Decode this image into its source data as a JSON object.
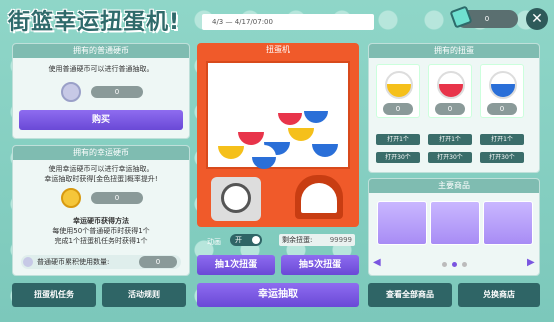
{
  "title": "街篮幸运扭蛋机!",
  "date_range": "4/3 — 4/17/07:00",
  "currency": {
    "value": "0"
  },
  "normal_coin": {
    "header": "拥有的普通硬币",
    "desc": "使用普通硬币可以进行普通抽取。",
    "count": "0",
    "buy_label": "购买"
  },
  "lucky_coin": {
    "header": "拥有的幸运硬币",
    "desc": [
      "使用幸运硬币可以进行幸运抽取。",
      "幸运抽取时获得[金色扭蛋]概率提升!"
    ],
    "count": "0",
    "method_title": "幸运硬币获得方法",
    "method_lines": [
      "每使用50个普通硬币时获得1个",
      "完成1个扭蛋机任务时获得1个"
    ],
    "accum_label": "普通硬币累积使用数量:",
    "accum_value": "0"
  },
  "machine": {
    "header": "扭蛋机",
    "anim_label": "动画",
    "toggle_label": "开",
    "remain_label": "剩余扭蛋:",
    "remain_value": "99999",
    "draw1_label": "抽1次扭蛋",
    "draw5_label": "抽5次扭蛋",
    "lucky_draw_label": "幸运抽取"
  },
  "owned": {
    "header": "拥有的扭蛋",
    "items": [
      {
        "color": "#f5c01a",
        "count": "0",
        "open1": "打开1个",
        "open30": "打开30个"
      },
      {
        "color": "#e8344a",
        "count": "0",
        "open1": "打开1个",
        "open30": "打开30个"
      },
      {
        "color": "#2a6fd8",
        "count": "0",
        "open1": "打开1个",
        "open30": "打开30个"
      }
    ]
  },
  "goods": {
    "header": "主要商品"
  },
  "bottom": {
    "mission_label": "扭蛋机任务",
    "rules_label": "活动规则",
    "view_all_label": "查看全部商品",
    "shop_label": "兑换商店"
  },
  "icons": [
    "close-icon",
    "coin-icon",
    "toggle-icon",
    "arrow-left-icon",
    "arrow-right-icon"
  ]
}
